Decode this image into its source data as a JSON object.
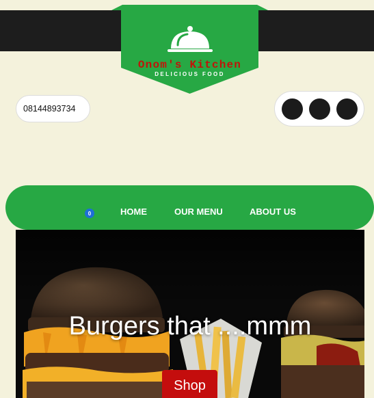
{
  "brand": {
    "name": "Onom's Kitchen",
    "tagline": "DELICIOUS FOOD",
    "icon": "cloche-icon",
    "colors": {
      "green": "#27a844",
      "red": "#c0140a",
      "dark": "#1d1d1d",
      "cream": "#f4f2dc"
    }
  },
  "contact": {
    "phone": "08144893734"
  },
  "social": {
    "icons": [
      "social-icon-1",
      "social-icon-2",
      "social-icon-3"
    ]
  },
  "nav": {
    "cart_count": "0",
    "items": [
      {
        "label": "HOME"
      },
      {
        "label": "OUR MENU"
      },
      {
        "label": "ABOUT US"
      }
    ]
  },
  "hero": {
    "heading": "Burgers that ....mmm",
    "button_label": "Shop",
    "button_color": "#c40d0d"
  }
}
